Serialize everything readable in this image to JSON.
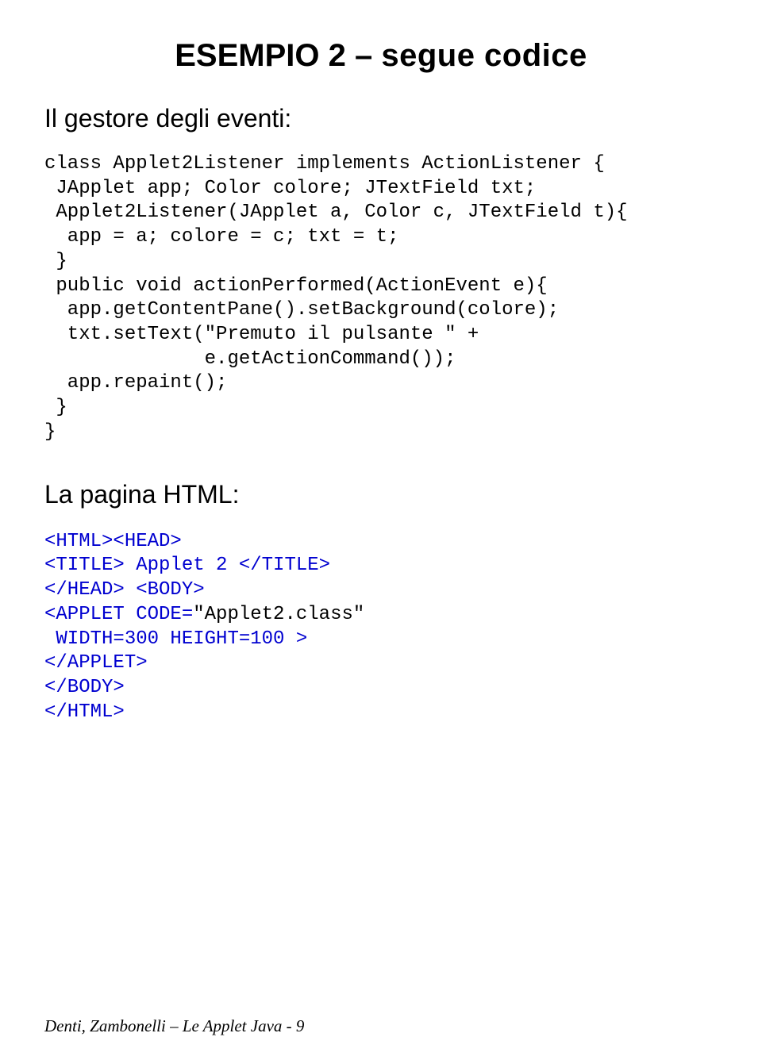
{
  "title": {
    "part1": "ESEMPIO 2 – ",
    "part2": "segue codice"
  },
  "heading1": "Il gestore degli eventi:",
  "code1": {
    "l1": "class Applet2Listener implements ActionListener {",
    "l2": " JApplet app; Color colore; JTextField txt;",
    "l3": " Applet2Listener(JApplet a, Color c, JTextField t){",
    "l4": "  app = a; colore = c; txt = t;",
    "l5": " }",
    "l6": " public void actionPerformed(ActionEvent e){",
    "l7": "  app.getContentPane().setBackground(colore);",
    "l8": "  txt.setText(\"Premuto il pulsante \" +",
    "l9": "              e.getActionCommand());",
    "l10": "  app.repaint();",
    "l11": " }",
    "l12": "}"
  },
  "heading2": "La pagina HTML:",
  "code2": {
    "l1": "<HTML><HEAD>",
    "l2": "<TITLE> Applet 2 </TITLE>",
    "l3": "</HEAD> <BODY>",
    "l4a": "<APPLET CODE=",
    "l4b": "\"Applet2.class\"",
    "l5": " WIDTH=300 HEIGHT=100 >",
    "l6": "</APPLET>",
    "l7": "</BODY>",
    "l8": "</HTML>"
  },
  "footer": "Denti, Zambonelli – Le Applet Java - 9"
}
